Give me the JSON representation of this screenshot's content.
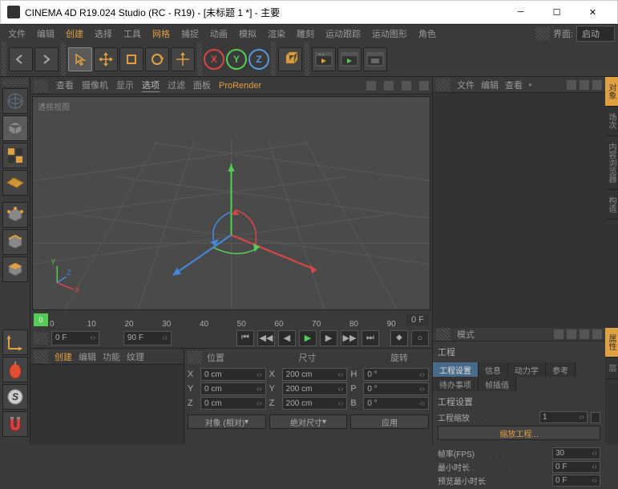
{
  "titlebar": {
    "text": "CINEMA 4D R19.024 Studio (RC - R19) - [未标题 1 *] - 主要"
  },
  "menubar": {
    "items": [
      "文件",
      "编辑",
      "创建",
      "选择",
      "工具",
      "网格",
      "捕捉",
      "动画",
      "模拟",
      "渲染",
      "雕刻",
      "运动跟踪",
      "运动图形",
      "角色"
    ],
    "orange_idx": [
      2,
      5
    ],
    "right_label": "界面:",
    "layout": "启动"
  },
  "vp_header": {
    "items": [
      "查看",
      "摄像机",
      "显示",
      "选项",
      "过滤",
      "面板"
    ],
    "prorender": "ProRender",
    "selected": "选项"
  },
  "vp_label": "透视视图",
  "timeline": {
    "ticks": [
      "0",
      "10",
      "20",
      "30",
      "40",
      "50",
      "60",
      "70",
      "80",
      "90"
    ],
    "end": "0 F"
  },
  "playback": {
    "start": "0 F",
    "end": "90 F"
  },
  "material_header": {
    "items": [
      "创建",
      "编辑",
      "功能",
      "纹理"
    ],
    "orange_idx": [
      0
    ]
  },
  "coord": {
    "headers": [
      "位置",
      "尺寸",
      "旋转"
    ],
    "rows": [
      {
        "a": "X",
        "p": "0 cm",
        "d": "X",
        "s": "200 cm",
        "r": "H",
        "v": "0 °"
      },
      {
        "a": "Y",
        "p": "0 cm",
        "d": "Y",
        "s": "200 cm",
        "r": "P",
        "v": "0 °"
      },
      {
        "a": "Z",
        "p": "0 cm",
        "d": "Z",
        "s": "200 cm",
        "r": "B",
        "v": "0 °"
      }
    ],
    "btn1": "对象 (相对)",
    "btn2": "绝对尺寸",
    "btn3": "应用"
  },
  "obj_header": {
    "items": [
      "文件",
      "编辑",
      "查看"
    ]
  },
  "attr": {
    "mode": "模式",
    "title": "工程",
    "tabs": [
      "工程设置",
      "信息",
      "动力学",
      "参考"
    ],
    "tabs2": [
      "待办事项",
      "帧插值"
    ],
    "section": "工程设置",
    "scale_label": "工程缩放",
    "scale_val": "1",
    "scale_btn": "缩放工程...",
    "fps_label": "帧率(FPS)",
    "fps_val": "30",
    "min_label": "最小时长",
    "min_val": "0 F",
    "prev_label": "预览最小时长",
    "prev_val": "0 F"
  },
  "vtabs": {
    "top": [
      "对象",
      "场次",
      "内容浏览器",
      "构造"
    ],
    "bottom": [
      "属性",
      "层"
    ]
  }
}
